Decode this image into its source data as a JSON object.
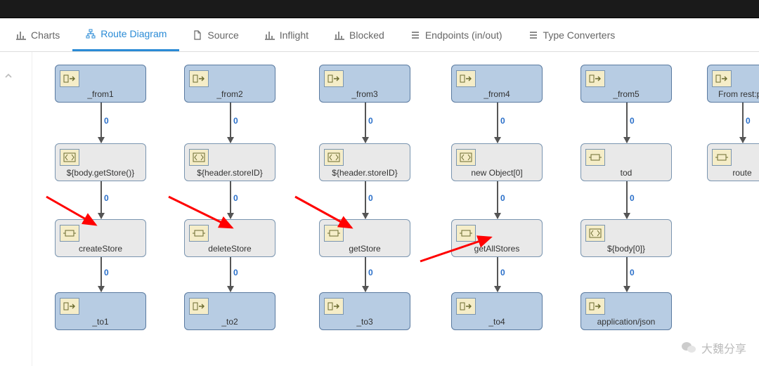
{
  "tabs": [
    {
      "label": "Charts"
    },
    {
      "label": "Route Diagram"
    },
    {
      "label": "Source"
    },
    {
      "label": "Inflight"
    },
    {
      "label": "Blocked"
    },
    {
      "label": "Endpoints (in/out)"
    },
    {
      "label": "Type Converters"
    }
  ],
  "edge_count": "0",
  "columns": [
    {
      "nodes": [
        {
          "label": "_from1",
          "type": "blue"
        },
        {
          "label": "${body.getStore()}",
          "type": "grey"
        },
        {
          "label": "createStore",
          "type": "grey"
        },
        {
          "label": "_to1",
          "type": "blue"
        }
      ]
    },
    {
      "nodes": [
        {
          "label": "_from2",
          "type": "blue"
        },
        {
          "label": "${header.storeID}",
          "type": "grey"
        },
        {
          "label": "deleteStore",
          "type": "grey"
        },
        {
          "label": "_to2",
          "type": "blue"
        }
      ]
    },
    {
      "nodes": [
        {
          "label": "_from3",
          "type": "blue"
        },
        {
          "label": "${header.storeID}",
          "type": "grey"
        },
        {
          "label": "getStore",
          "type": "grey"
        },
        {
          "label": "_to3",
          "type": "blue"
        }
      ]
    },
    {
      "nodes": [
        {
          "label": "_from4",
          "type": "blue"
        },
        {
          "label": "new Object[0]",
          "type": "grey"
        },
        {
          "label": "getAllStores",
          "type": "grey"
        },
        {
          "label": "_to4",
          "type": "blue"
        }
      ]
    },
    {
      "nodes": [
        {
          "label": "_from5",
          "type": "blue"
        },
        {
          "label": "tod",
          "type": "grey"
        },
        {
          "label": "${body[0]}",
          "type": "grey"
        },
        {
          "label": "application/json",
          "type": "blue"
        }
      ]
    },
    {
      "nodes": [
        {
          "label": "From rest:po",
          "type": "blue"
        },
        {
          "label": "route",
          "type": "grey"
        }
      ]
    }
  ],
  "watermark_text": "大魏分享"
}
